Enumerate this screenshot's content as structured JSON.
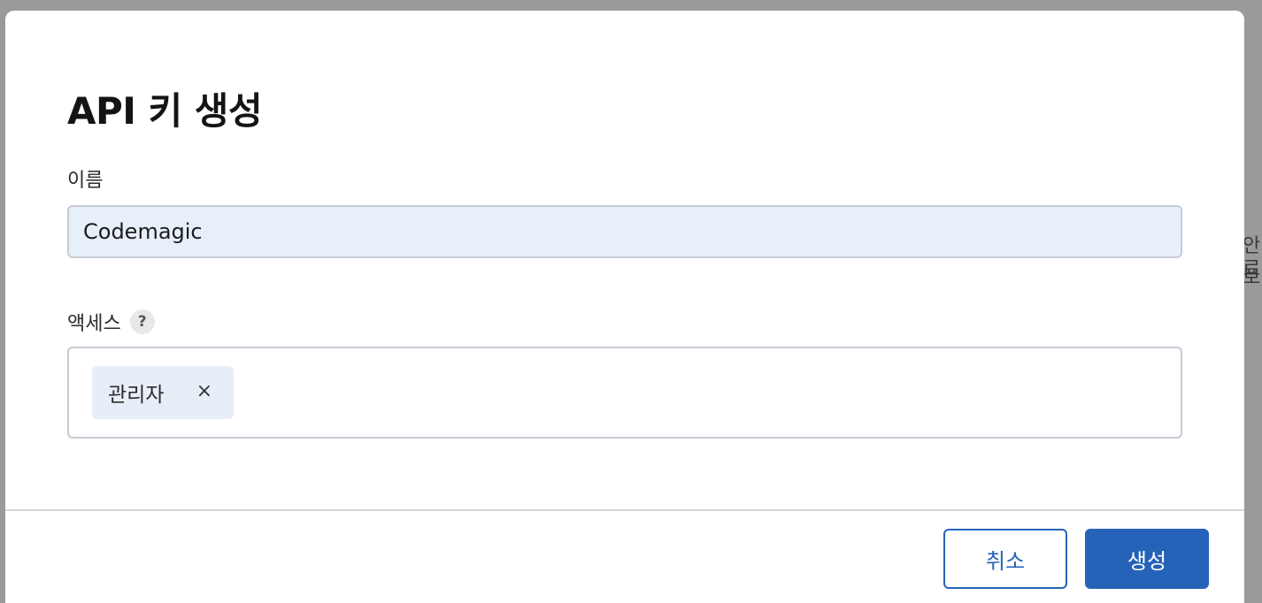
{
  "backdrop": {
    "edge_text_1": "안료",
    "edge_text_2": "보"
  },
  "modal": {
    "title": "API 키 생성",
    "name_field": {
      "label": "이름",
      "value": "Codemagic"
    },
    "access_field": {
      "label": "액세스",
      "help_icon": "?",
      "chips": [
        {
          "label": "관리자",
          "remove_icon": "×"
        }
      ]
    },
    "footer": {
      "cancel_label": "취소",
      "create_label": "생성"
    }
  },
  "colors": {
    "primary": "#2563b8",
    "input_fill": "#e7effb",
    "chip_fill": "#e7eef8",
    "overlay": "#9a9a9a"
  }
}
